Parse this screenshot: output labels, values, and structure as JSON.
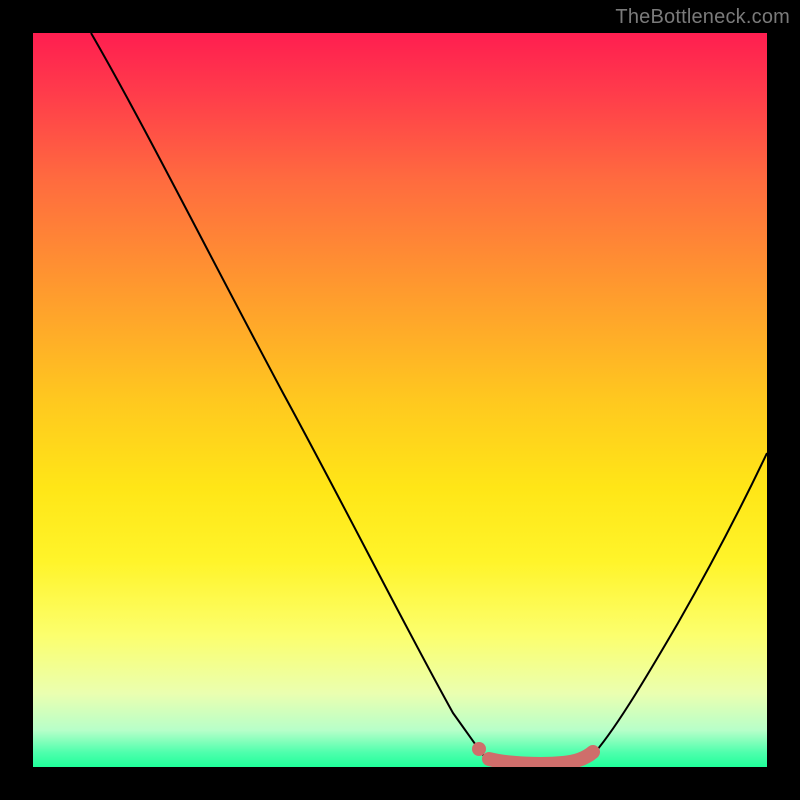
{
  "attribution": "TheBottleneck.com",
  "chart_data": {
    "type": "line",
    "title": "",
    "xlabel": "",
    "ylabel": "",
    "xlim": [
      0,
      100
    ],
    "ylim": [
      0,
      100
    ],
    "background": "traffic-light-gradient",
    "description": "V-shaped bottleneck curve: two branches descending to a flat minimum near zero; minimum region highlighted in salmon.",
    "series": [
      {
        "name": "left-branch",
        "x": [
          8,
          15,
          25,
          35,
          45,
          52,
          58,
          60
        ],
        "values": [
          100,
          88,
          70,
          52,
          33,
          18,
          6,
          2
        ]
      },
      {
        "name": "right-branch",
        "x": [
          74,
          78,
          84,
          90,
          96,
          100
        ],
        "values": [
          2,
          8,
          18,
          30,
          42,
          50
        ]
      },
      {
        "name": "minimum-plateau",
        "x": [
          60,
          63,
          67,
          71,
          74
        ],
        "values": [
          2,
          1,
          1,
          1,
          2
        ]
      }
    ],
    "highlight": {
      "name": "optimal-range",
      "x_range": [
        59,
        75
      ],
      "y": 1.5
    }
  }
}
